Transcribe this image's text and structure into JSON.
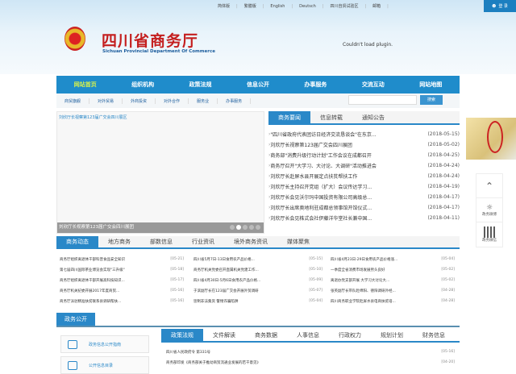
{
  "topbar": {
    "links": [
      "简体版",
      "繁體版",
      "English",
      "Deutsch",
      "四川自贸试验区",
      "邮箱"
    ],
    "login": "登 录"
  },
  "header": {
    "title": "四川省商务厅",
    "subtitle": "Sichuan Provincial Department Of Commerce",
    "plugin_msg": "Couldn't load plugin."
  },
  "nav": [
    "网站首页",
    "组织机构",
    "政策法规",
    "信息公开",
    "办事服务",
    "交流互动",
    "网站地图"
  ],
  "subnav": [
    "商贸旗舰",
    "对外贸易",
    "外商投资",
    "对外合作",
    "服务业",
    "办事服务"
  ],
  "search": {
    "placeholder": "",
    "button": "搜索"
  },
  "slide": {
    "caption": "刘欣厅长视察第123届广交会四川展区",
    "bar": "刘欣厅长视察第123届广交会四川展团",
    "dots": 5,
    "active_dot": 2
  },
  "news_tabs": [
    "商务要闻",
    "信息转载",
    "通知公告"
  ],
  "news": [
    {
      "t": "\"四川省政府代表团访日经济交流恳谈会\"在东京...",
      "d": "(2018-05-15)"
    },
    {
      "t": "刘欣厅长视察第123届广交会四川展团",
      "d": "(2018-05-02)"
    },
    {
      "t": "商务部\"消费升级行动计划\"工作会议在成都召开",
      "d": "(2018-04-25)"
    },
    {
      "t": "商务厅召开\"大学习、大讨论、大调研\"活动推进会",
      "d": "(2018-04-24)"
    },
    {
      "t": "刘欣厅长赴屏水县开展定点扶贫帮扶工作",
      "d": "(2018-04-24)"
    },
    {
      "t": "刘欣厅长主持召开党组（扩大）会议传达学习...",
      "d": "(2018-04-19)"
    },
    {
      "t": "刘欣厅长会见沃尔玛中国投资有限公司高级总...",
      "d": "(2018-04-17)"
    },
    {
      "t": "刘欣厅长出席奥地利驻成都总领事馆开馆仪式...",
      "d": "(2018-04-17)"
    },
    {
      "t": "刘欣厅长会见株式会社伊藤洋华堂社长兼中国...",
      "d": "(2018-04-11)"
    }
  ],
  "dyn_tabs": [
    "商务动态",
    "地方商务",
    "部数信息",
    "行业资讯",
    "境外商务资讯",
    "媒体聚焦"
  ],
  "dyn_cols": [
    [
      {
        "t": "商务厅组织离退休干部科普食品安全知识",
        "d": "[05-21]"
      },
      {
        "t": "第七届四川国际茶业博览会实现\"三升级\"",
        "d": "[05-18]"
      },
      {
        "t": "商务厅组织离退休干部开展高科技知识...",
        "d": "[05-17]"
      },
      {
        "t": "商务厅机关纪委开展2017年度商贸...",
        "d": "[05-16]"
      },
      {
        "t": "商务厅派驻精准扶贫联系县调研帮扶...",
        "d": "[05-16]"
      }
    ],
    [
      {
        "t": "四川省5月7日-13日食用农产品价格...",
        "d": "[05-15]"
      },
      {
        "t": "商务厅机关党委召开直属机关党建工作...",
        "d": "[05-10]"
      },
      {
        "t": "四川省4月30日-5月6日食用农产品价格...",
        "d": "[05-09]"
      },
      {
        "t": "于滨副厅长在123届广交会开展外贸调研",
        "d": "[05-07]"
      },
      {
        "t": "惩制非法集资 警惕诈骗陷阱",
        "d": "[05-04]"
      }
    ],
    [
      {
        "t": "四川省4月23日-29日食用农产品价格涨...",
        "d": "[05-04]"
      },
      {
        "t": "一季度全省消费市场发展势头良好",
        "d": "[05-02]"
      },
      {
        "t": "离退办党支部开展 大学习大讨论大...",
        "d": "[05-02]"
      },
      {
        "t": "张英副厅长带队赴绵阳、德阳调研外经...",
        "d": "[04-28]"
      },
      {
        "t": "四川商务职业学院赴屏水县电商扶贫培...",
        "d": "[04-28]"
      }
    ]
  ],
  "gov": {
    "title": "政务公开",
    "side": [
      "政务信息公开指南",
      "公开信息目录"
    ],
    "tabs": [
      "政策法规",
      "文件解读",
      "商务数据",
      "人事信息",
      "行政权力",
      "规划计划",
      "财务信息"
    ],
    "rows": [
      {
        "t": "四川省人民政府令 第331号",
        "d": "[05-16]"
      },
      {
        "t": "商务部印发《商务部关于推动商贸流通业发展的若干意见》",
        "d": "[04-20]"
      }
    ]
  },
  "float": {
    "weibo": "政务微博",
    "wechat": "政务微信"
  },
  "colors": {
    "nav": "#1f8ccb",
    "active_nav": "#d8f14a",
    "title": "#c41f1f"
  }
}
